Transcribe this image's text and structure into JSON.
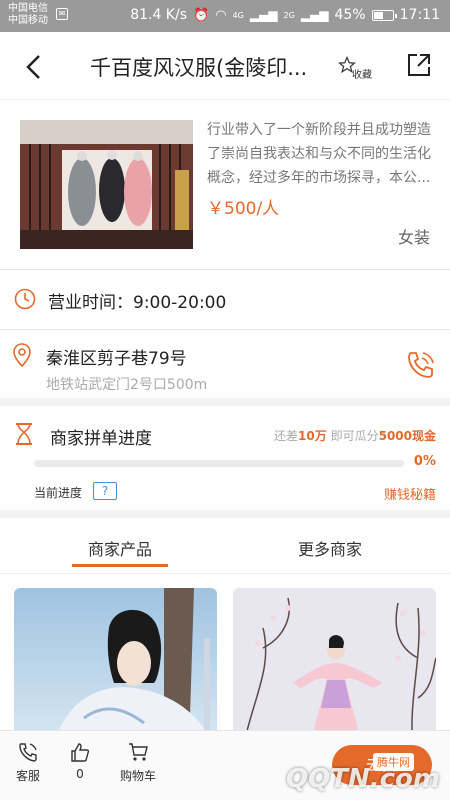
{
  "status_bar": {
    "carrier_1": "中国电信",
    "carrier_2": "中国移动",
    "speed": "81.4 K/s",
    "network_4g": "4G",
    "network_2g": "2G",
    "battery": "45%",
    "time": "17:11"
  },
  "header": {
    "title": "千百度风汉服(金陵印...",
    "favorite_label": "收藏"
  },
  "shop": {
    "description": "行业带入了一个新阶段并且成功塑造了崇尚自我表达和与众不同的生活化概念，经过多年的市场探寻，本公...",
    "price": "￥500/人",
    "category": "女装"
  },
  "hours": {
    "text": "营业时间：9:00-20:00"
  },
  "address": {
    "main": "秦淮区剪子巷79号",
    "sub": "地铁站武定门2号口500m"
  },
  "progress": {
    "title": "商家拼单进度",
    "stat_prefix": "还差",
    "stat_amount": "10万",
    "stat_middle": "即可瓜分",
    "stat_reward": "5000现金",
    "percent_text": "0%",
    "percent_value": 0,
    "current_label": "当前进度",
    "help_symbol": "?",
    "secret_link": "赚钱秘籍"
  },
  "tabs": [
    {
      "label": "商家产品",
      "active": true
    },
    {
      "label": "更多商家",
      "active": false
    }
  ],
  "bottom_nav": {
    "service_label": "客服",
    "like_count": "0",
    "cart_label": "购物车",
    "cta_label": "去拼",
    "badge": "腾牛网",
    "watermark": "QQTN.com"
  },
  "colors": {
    "accent": "#e46a2c",
    "help_blue": "#4a90e2"
  }
}
